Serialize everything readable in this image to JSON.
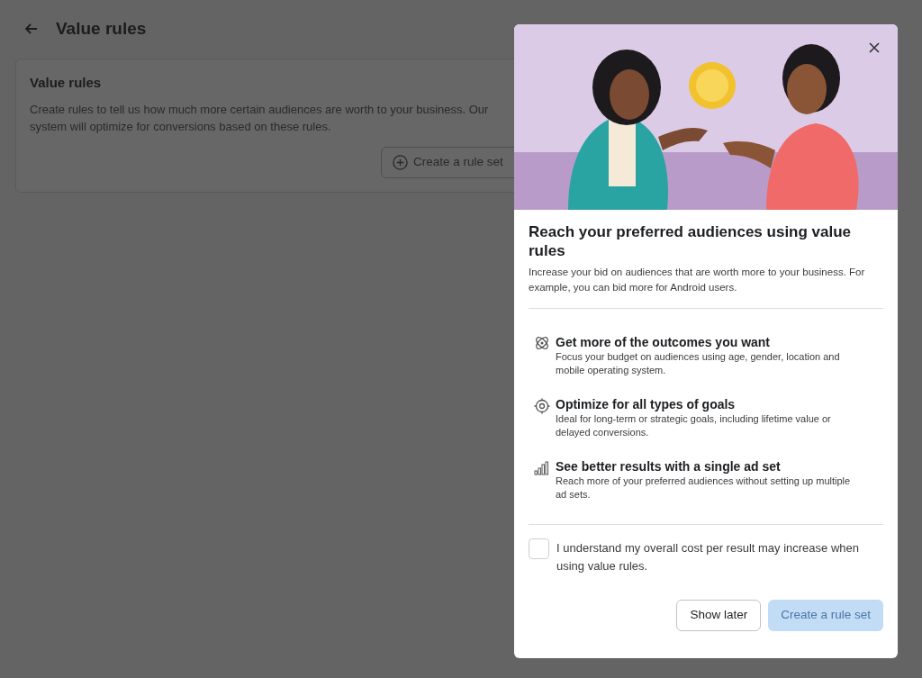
{
  "page": {
    "title": "Value rules"
  },
  "card": {
    "title": "Value rules",
    "description": "Create rules to tell us how much more certain audiences are worth to your business. Our system will optimize for conversions based on these rules.",
    "button": "Create a rule set"
  },
  "dialog": {
    "title": "Reach your preferred audiences using value rules",
    "description": "Increase your bid on audiences that are worth more to your business. For example, you can bid more for Android users.",
    "features": [
      {
        "kind": "atom",
        "title": "Get more of the outcomes you want",
        "description": "Focus your budget on audiences using age, gender, location and mobile operating system."
      },
      {
        "kind": "target",
        "title": "Optimize for all types of goals",
        "description": "Ideal for long-term or strategic goals, including lifetime value or delayed conversions."
      },
      {
        "kind": "chart",
        "title": "See better results with a single ad set",
        "description": "Reach more of your preferred audiences without setting up multiple ad sets."
      }
    ],
    "consent": {
      "label": "I understand my overall cost per result may increase when using value rules.",
      "checked": false
    },
    "buttons": [
      {
        "label": "Show later",
        "kind": "secondary",
        "disabled": false
      },
      {
        "label": "Create a rule set",
        "kind": "primary",
        "disabled": true
      }
    ]
  }
}
